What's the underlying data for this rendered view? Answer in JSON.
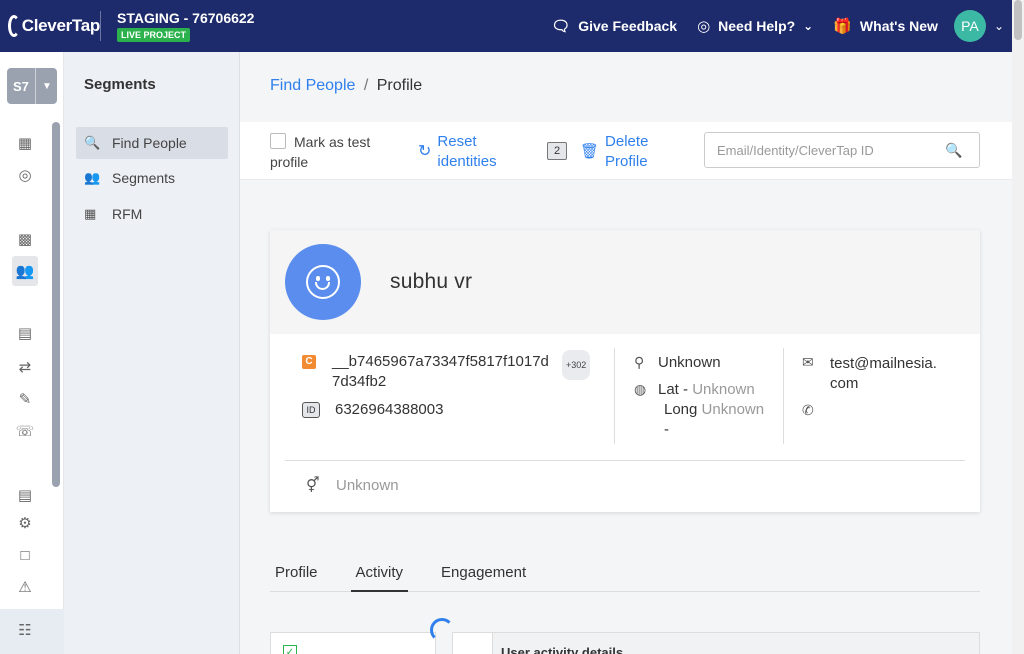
{
  "topbar": {
    "logo": "CleverTap",
    "project_name": "STAGING - 76706622",
    "project_badge": "LIVE PROJECT",
    "feedback": "Give Feedback",
    "help": "Need Help?",
    "whats_new": "What's New",
    "avatar_initials": "PA"
  },
  "rail": {
    "project_code": "S7"
  },
  "subnav": {
    "title": "Segments",
    "items": [
      {
        "label": "Find People"
      },
      {
        "label": "Segments"
      },
      {
        "label": "RFM"
      }
    ]
  },
  "breadcrumb": {
    "parent": "Find People",
    "separator": "/",
    "current": "Profile"
  },
  "actions": {
    "mark_test": "Mark as test profile",
    "reset": "Reset identities",
    "count": "2",
    "delete": "Delete Profile",
    "search_placeholder": "Email/Identity/CleverTap ID"
  },
  "profile": {
    "name": "subhu vr",
    "clevertap_id": "__b7465967a73347f5817f1017d7d34fb2",
    "id_count": "+302",
    "identity": "6326964388003",
    "location": "Unknown",
    "lat_label": "Lat -",
    "lat_value": "Unknown",
    "long_label": "Long",
    "long_value": "Unknown",
    "long_suffix": "-",
    "email": "test@mailnesia.com",
    "gender": "Unknown"
  },
  "tabs": [
    {
      "label": "Profile"
    },
    {
      "label": "Activity"
    },
    {
      "label": "Engagement"
    }
  ],
  "activity": {
    "title": "User activity details"
  },
  "colors": {
    "topbar": "#1d2a6b",
    "accent": "#2f80ed",
    "live": "#2bb24c",
    "avatar": "#5a8dee"
  }
}
